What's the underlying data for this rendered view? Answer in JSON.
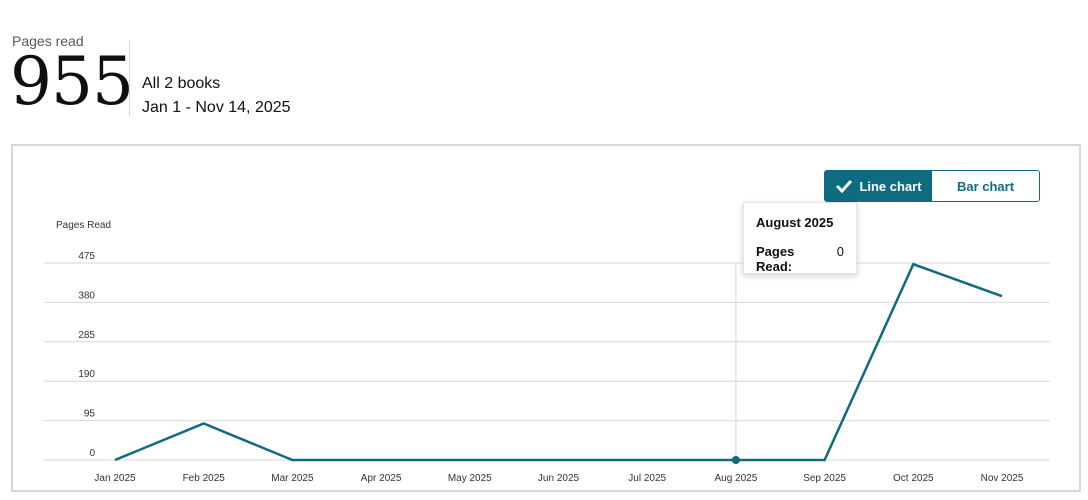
{
  "summary": {
    "pages_label": "Pages read",
    "pages_total": "955",
    "books_label": "All 2 books",
    "date_range": "Jan 1 - Nov 14, 2025"
  },
  "toggle": {
    "line_label": "Line chart",
    "bar_label": "Bar chart"
  },
  "tooltip": {
    "title": "August 2025",
    "key": "Pages Read:",
    "value": "0"
  },
  "colors": {
    "line": "#0f6b81",
    "grid": "#d5d9d9"
  },
  "chart_data": {
    "type": "line",
    "title": "",
    "xlabel": "",
    "ylabel": "Pages Read",
    "categories": [
      "Jan 2025",
      "Feb 2025",
      "Mar 2025",
      "Apr 2025",
      "May 2025",
      "Jun 2025",
      "Jul 2025",
      "Aug 2025",
      "Sep 2025",
      "Oct 2025",
      "Nov 2025"
    ],
    "series": [
      {
        "values": [
          0,
          88,
          0,
          0,
          0,
          0,
          0,
          0,
          0,
          472,
          395
        ]
      }
    ],
    "yticks": [
      0,
      95,
      190,
      285,
      380,
      475
    ],
    "ylim": [
      0,
      475
    ],
    "grid": true,
    "highlighted_category": "Aug 2025"
  }
}
